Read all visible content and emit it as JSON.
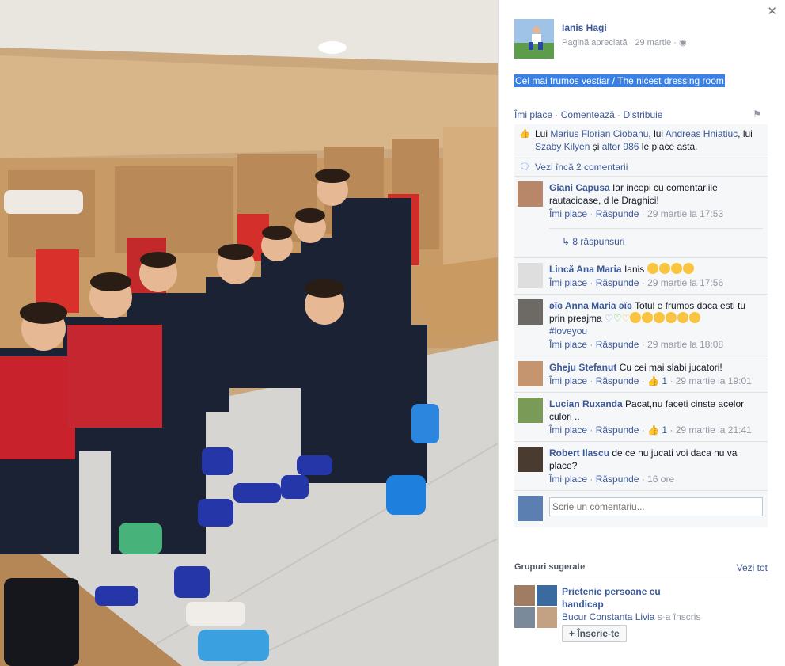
{
  "post": {
    "page_name": "Ianis Hagi",
    "liked_page_label": "Pagină apreciată",
    "date": "29 martie",
    "caption": "Cel mai frumos vestiar / The nicest dressing room"
  },
  "actions": {
    "like": "Îmi place",
    "comment": "Comentează",
    "share": "Distribuie"
  },
  "likes": {
    "prefix": "Lui",
    "person1": "Marius Florian Ciobanu",
    "mid1": ", lui",
    "person2": "Andreas Hniatiuc",
    "mid2": ", lui",
    "person3": "Szaby Kilyen",
    "mid3": "și",
    "others": "altor 986",
    "suffix": "le place asta."
  },
  "view_more": "Vezi încă 2 comentarii",
  "comments": [
    {
      "author": "Giani Capusa",
      "text": "Iar incepi cu comentariile rautacioase, d le Draghici!",
      "like": "Îmi place",
      "reply": "Răspunde",
      "time": "29 martie la 17:53",
      "replies": "8 răspunsuri"
    },
    {
      "author": "Lincă Ana Maria",
      "text": "Ianis",
      "like": "Îmi place",
      "reply": "Răspunde",
      "time": "29 martie la 17:56"
    },
    {
      "author": "ʚϊɞ Anna Maria ʚϊɞ",
      "text": "Totul e frumos daca esti tu prin preajma",
      "tag": "#loveyou",
      "like": "Îmi place",
      "reply": "Răspunde",
      "time": "29 martie la 18:08"
    },
    {
      "author": "Gheju Stefanut",
      "text": "Cu cei mai slabi jucatori!",
      "like": "Îmi place",
      "reply": "Răspunde",
      "likes": "1",
      "time": "29 martie la 19:01"
    },
    {
      "author": "Lucian Ruxanda",
      "text": "Pacat,nu faceti cinste acelor culori ..",
      "like": "Îmi place",
      "reply": "Răspunde",
      "likes": "1",
      "time": "29 martie la 21:41"
    },
    {
      "author": "Robert Ilascu",
      "text": "de ce nu jucati voi daca nu va place?",
      "like": "Îmi place",
      "reply": "Răspunde",
      "time": "16 ore"
    }
  ],
  "write_placeholder": "Scrie un comentariu...",
  "groups": {
    "title": "Grupuri sugerate",
    "see_all": "Vezi tot",
    "name": "Prietenie persoane cu handicap",
    "member": "Bucur Constanta Livia",
    "member_action": "s-a înscris",
    "join": "Înscrie-te"
  }
}
